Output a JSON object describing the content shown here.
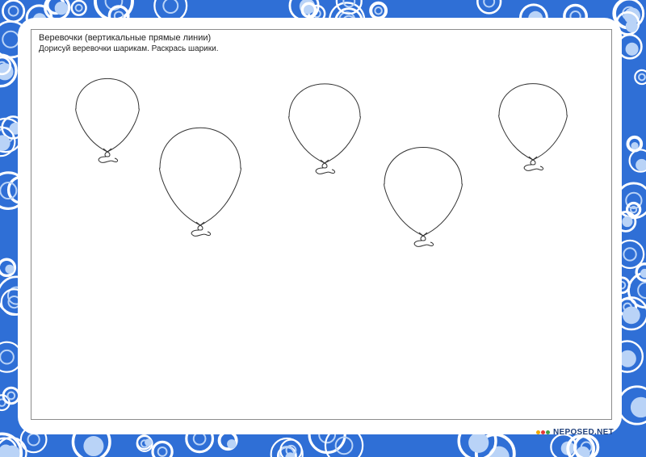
{
  "worksheet": {
    "title": "Веревочки (вертикальные прямые линии)",
    "instruction": "Дорисуй веревочки шарикам. Раскрась шарики."
  },
  "brand": {
    "name": "NEPOSED.NET"
  },
  "colors": {
    "frame_blue": "#2f6fd6",
    "bubble_light": "#b9d3f7",
    "bubble_white": "#ffffff",
    "outline": "#333333"
  }
}
